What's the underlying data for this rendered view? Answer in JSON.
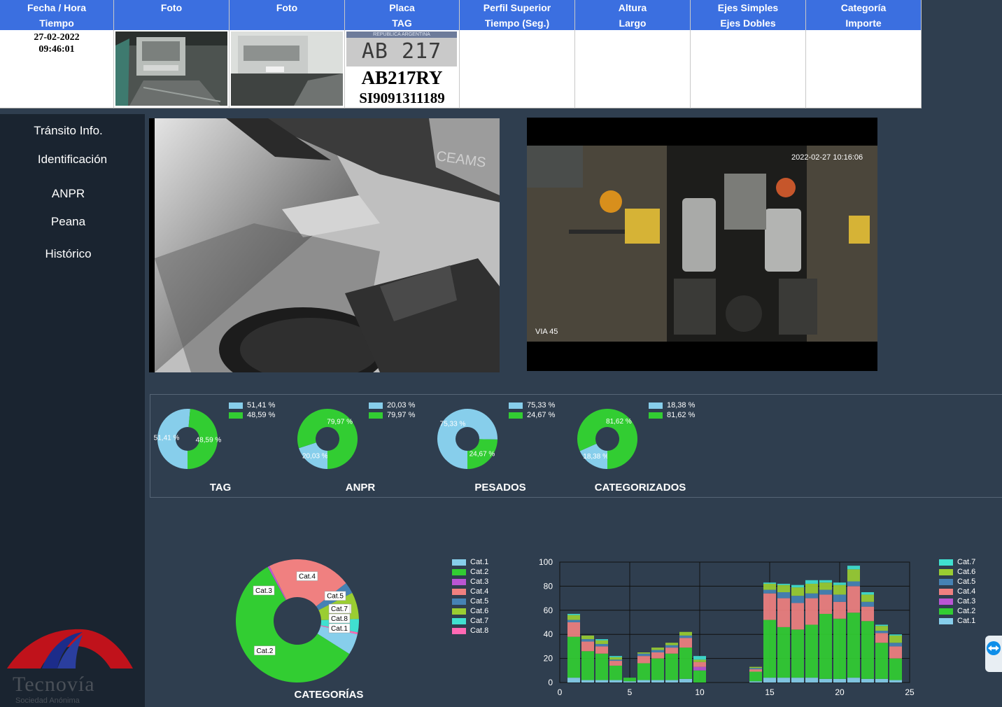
{
  "header": {
    "columns": [
      {
        "line1": "Fecha / Hora",
        "line2": "Tiempo"
      },
      {
        "line1": "Foto",
        "line2": ""
      },
      {
        "line1": "Foto",
        "line2": ""
      },
      {
        "line1": "Placa",
        "line2": "TAG"
      },
      {
        "line1": "Perfil Superior",
        "line2": "Tiempo (Seg.)"
      },
      {
        "line1": "Altura",
        "line2": "Largo"
      },
      {
        "line1": "Ejes Simples",
        "line2": "Ejes Dobles"
      },
      {
        "line1": "Categoría",
        "line2": "Importe"
      }
    ],
    "row": {
      "date": "27-02-2022",
      "time": "09:46:01",
      "plate_image_text": "AB 217 RY",
      "plate_country": "REPUBLICA ARGENTINA",
      "plate": "AB217RY",
      "tag": "SI9091311189"
    }
  },
  "sidebar": {
    "items": [
      "Tránsito Info.",
      "Identificación",
      "ANPR",
      "Peana",
      "Histórico"
    ],
    "logo_text": "Tecnovía",
    "logo_subtext": "Sociedad Anónima"
  },
  "cameras": {
    "cam1_overlay": "CEAMS",
    "cam2_timestamp": "2022-02-27 10:16:06",
    "cam2_label": "VIA 45"
  },
  "donuts": [
    {
      "title": "TAG",
      "legend": [
        "51,41 %",
        "48,59 %"
      ],
      "values": [
        51.41,
        48.59
      ],
      "colors": [
        "#87ceeb",
        "#32cd32"
      ],
      "labels": [
        "51,41 %",
        "48,59 %"
      ]
    },
    {
      "title": "ANPR",
      "legend": [
        "20,03 %",
        "79,97 %"
      ],
      "values": [
        20.03,
        79.97
      ],
      "colors": [
        "#87ceeb",
        "#32cd32"
      ],
      "labels": [
        "20,03 %",
        "79,97 %"
      ]
    },
    {
      "title": "PESADOS",
      "legend": [
        "75,33 %",
        "24,67 %"
      ],
      "values": [
        75.33,
        24.67
      ],
      "colors": [
        "#87ceeb",
        "#32cd32"
      ],
      "labels": [
        "75,33 %",
        "24,67 %"
      ]
    },
    {
      "title": "CATEGORIZADOS",
      "legend": [
        "18,38 %",
        "81,62 %"
      ],
      "values": [
        18.38,
        81.62
      ],
      "colors": [
        "#87ceeb",
        "#32cd32"
      ],
      "labels": [
        "18,38 %",
        "81,62 %"
      ]
    }
  ],
  "categorias": {
    "title": "CATEGORÍAS",
    "legend": [
      "Cat.1",
      "Cat.2",
      "Cat.3",
      "Cat.4",
      "Cat.5",
      "Cat.6",
      "Cat.7",
      "Cat.8"
    ],
    "colors": {
      "Cat.1": "#87ceeb",
      "Cat.2": "#32cd32",
      "Cat.3": "#ba55d3",
      "Cat.4": "#f08080",
      "Cat.5": "#4682b4",
      "Cat.6": "#9acd32",
      "Cat.7": "#40e0d0",
      "Cat.8": "#ff69b4"
    }
  },
  "chart_data": [
    {
      "type": "pie",
      "title": "CATEGORÍAS",
      "categories": [
        "Cat.2",
        "Cat.3",
        "Cat.4",
        "Cat.5",
        "Cat.6",
        "Cat.7",
        "Cat.8",
        "Cat.1"
      ],
      "values": [
        58,
        0.5,
        22,
        3,
        7,
        3.5,
        0.5,
        5.5
      ]
    },
    {
      "type": "bar",
      "stacked": true,
      "x": [
        1,
        2,
        3,
        4,
        5,
        6,
        7,
        8,
        9,
        10,
        14,
        15,
        16,
        17,
        18,
        19,
        20,
        21,
        22,
        23,
        24
      ],
      "xlim": [
        0,
        25
      ],
      "xticks": [
        0,
        5,
        10,
        15,
        20,
        25
      ],
      "ylim": [
        0,
        100
      ],
      "yticks": [
        0,
        20,
        40,
        60,
        80,
        100
      ],
      "grid": true,
      "legend": "right",
      "series": [
        {
          "name": "Cat.1",
          "values": [
            4,
            2,
            2,
            2,
            1,
            2,
            2,
            2,
            3,
            0,
            1,
            4,
            4,
            4,
            4,
            3,
            3,
            4,
            3,
            3,
            2
          ]
        },
        {
          "name": "Cat.2",
          "values": [
            34,
            24,
            22,
            12,
            3,
            14,
            18,
            22,
            26,
            10,
            8,
            48,
            42,
            40,
            44,
            54,
            50,
            54,
            48,
            30,
            18
          ]
        },
        {
          "name": "Cat.3",
          "values": [
            0,
            0,
            0,
            0,
            0,
            0,
            0,
            0,
            0,
            3,
            0,
            0,
            0,
            0,
            0,
            0,
            0,
            0,
            0,
            0,
            0
          ]
        },
        {
          "name": "Cat.4",
          "values": [
            12,
            8,
            6,
            4,
            0,
            6,
            5,
            5,
            8,
            4,
            2,
            22,
            24,
            22,
            22,
            16,
            14,
            22,
            12,
            8,
            10
          ]
        },
        {
          "name": "Cat.5",
          "values": [
            2,
            2,
            2,
            1,
            0,
            2,
            2,
            2,
            2,
            0,
            1,
            3,
            5,
            6,
            4,
            4,
            6,
            4,
            4,
            2,
            3
          ]
        },
        {
          "name": "Cat.6",
          "values": [
            4,
            3,
            3,
            2,
            0,
            1,
            2,
            2,
            3,
            2,
            1,
            5,
            6,
            7,
            8,
            6,
            8,
            10,
            6,
            4,
            6
          ]
        },
        {
          "name": "Cat.7",
          "values": [
            1,
            0,
            1,
            1,
            0,
            0,
            0,
            0,
            0,
            3,
            0,
            1,
            1,
            2,
            3,
            2,
            2,
            3,
            2,
            1,
            1
          ]
        },
        {
          "name": "Cat.8",
          "values": [
            0,
            0,
            0,
            0,
            0,
            0,
            0,
            0,
            0,
            0,
            0,
            0,
            0,
            0,
            0,
            0,
            0,
            0,
            0,
            0,
            0
          ]
        }
      ]
    }
  ]
}
